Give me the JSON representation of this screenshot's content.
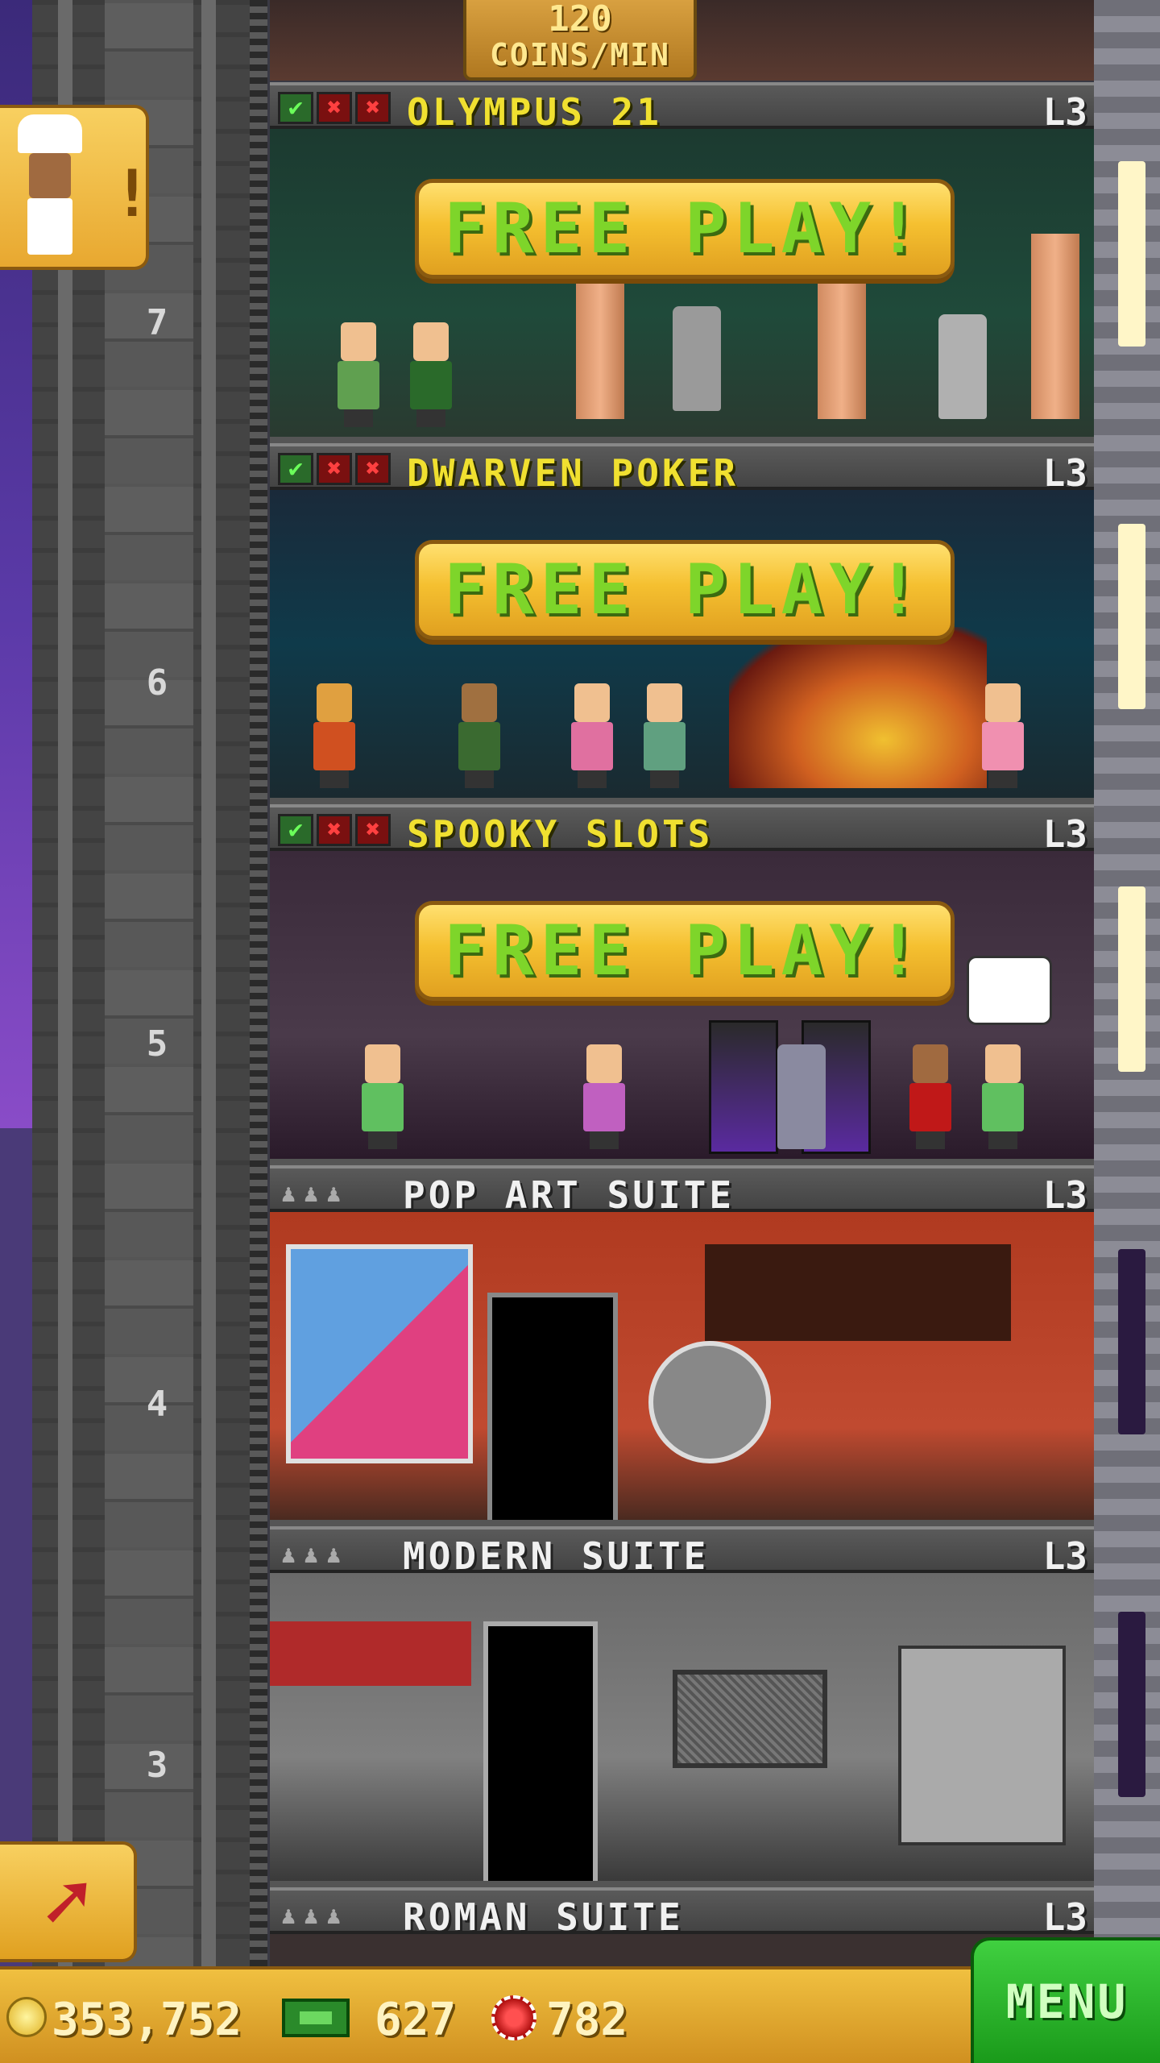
{
  "top_banner": {
    "amount": "120",
    "unit": "COINS/MIN"
  },
  "floors": [
    {
      "title": "OLYMPUS 21",
      "level": "L3",
      "floor_number": "7",
      "status": [
        "check",
        "x",
        "x"
      ],
      "free_play": "FREE  PLAY!"
    },
    {
      "title": "DWARVEN POKER",
      "level": "L3",
      "floor_number": "6",
      "status": [
        "check",
        "x",
        "x"
      ],
      "free_play": "FREE  PLAY!"
    },
    {
      "title": "SPOOKY SLOTS",
      "level": "L3",
      "floor_number": "5",
      "status": [
        "check",
        "x",
        "x"
      ],
      "free_play": "FREE  PLAY!"
    },
    {
      "title": "POP ART SUITE",
      "level": "L3",
      "floor_number": "4"
    },
    {
      "title": "MODERN SUITE",
      "level": "L3",
      "floor_number": "3"
    },
    {
      "title": "ROMAN SUITE",
      "level": "L3"
    }
  ],
  "status_symbols": {
    "check": "✔",
    "x": "✖"
  },
  "resources": {
    "coins": "353,752",
    "bux": "627",
    "chips": "782"
  },
  "menu_label": "MENU",
  "colors": {
    "accent_yellow": "#f0e030",
    "free_play_text": "#7ed52a",
    "menu_green": "#1a9a1a",
    "bar_gold": "#e0a020"
  },
  "icons": {
    "coin": "coin-icon",
    "bux": "bux-icon",
    "chip": "chip-icon",
    "chef_notification": "chef-icon",
    "rocket": "rocket-icon"
  }
}
